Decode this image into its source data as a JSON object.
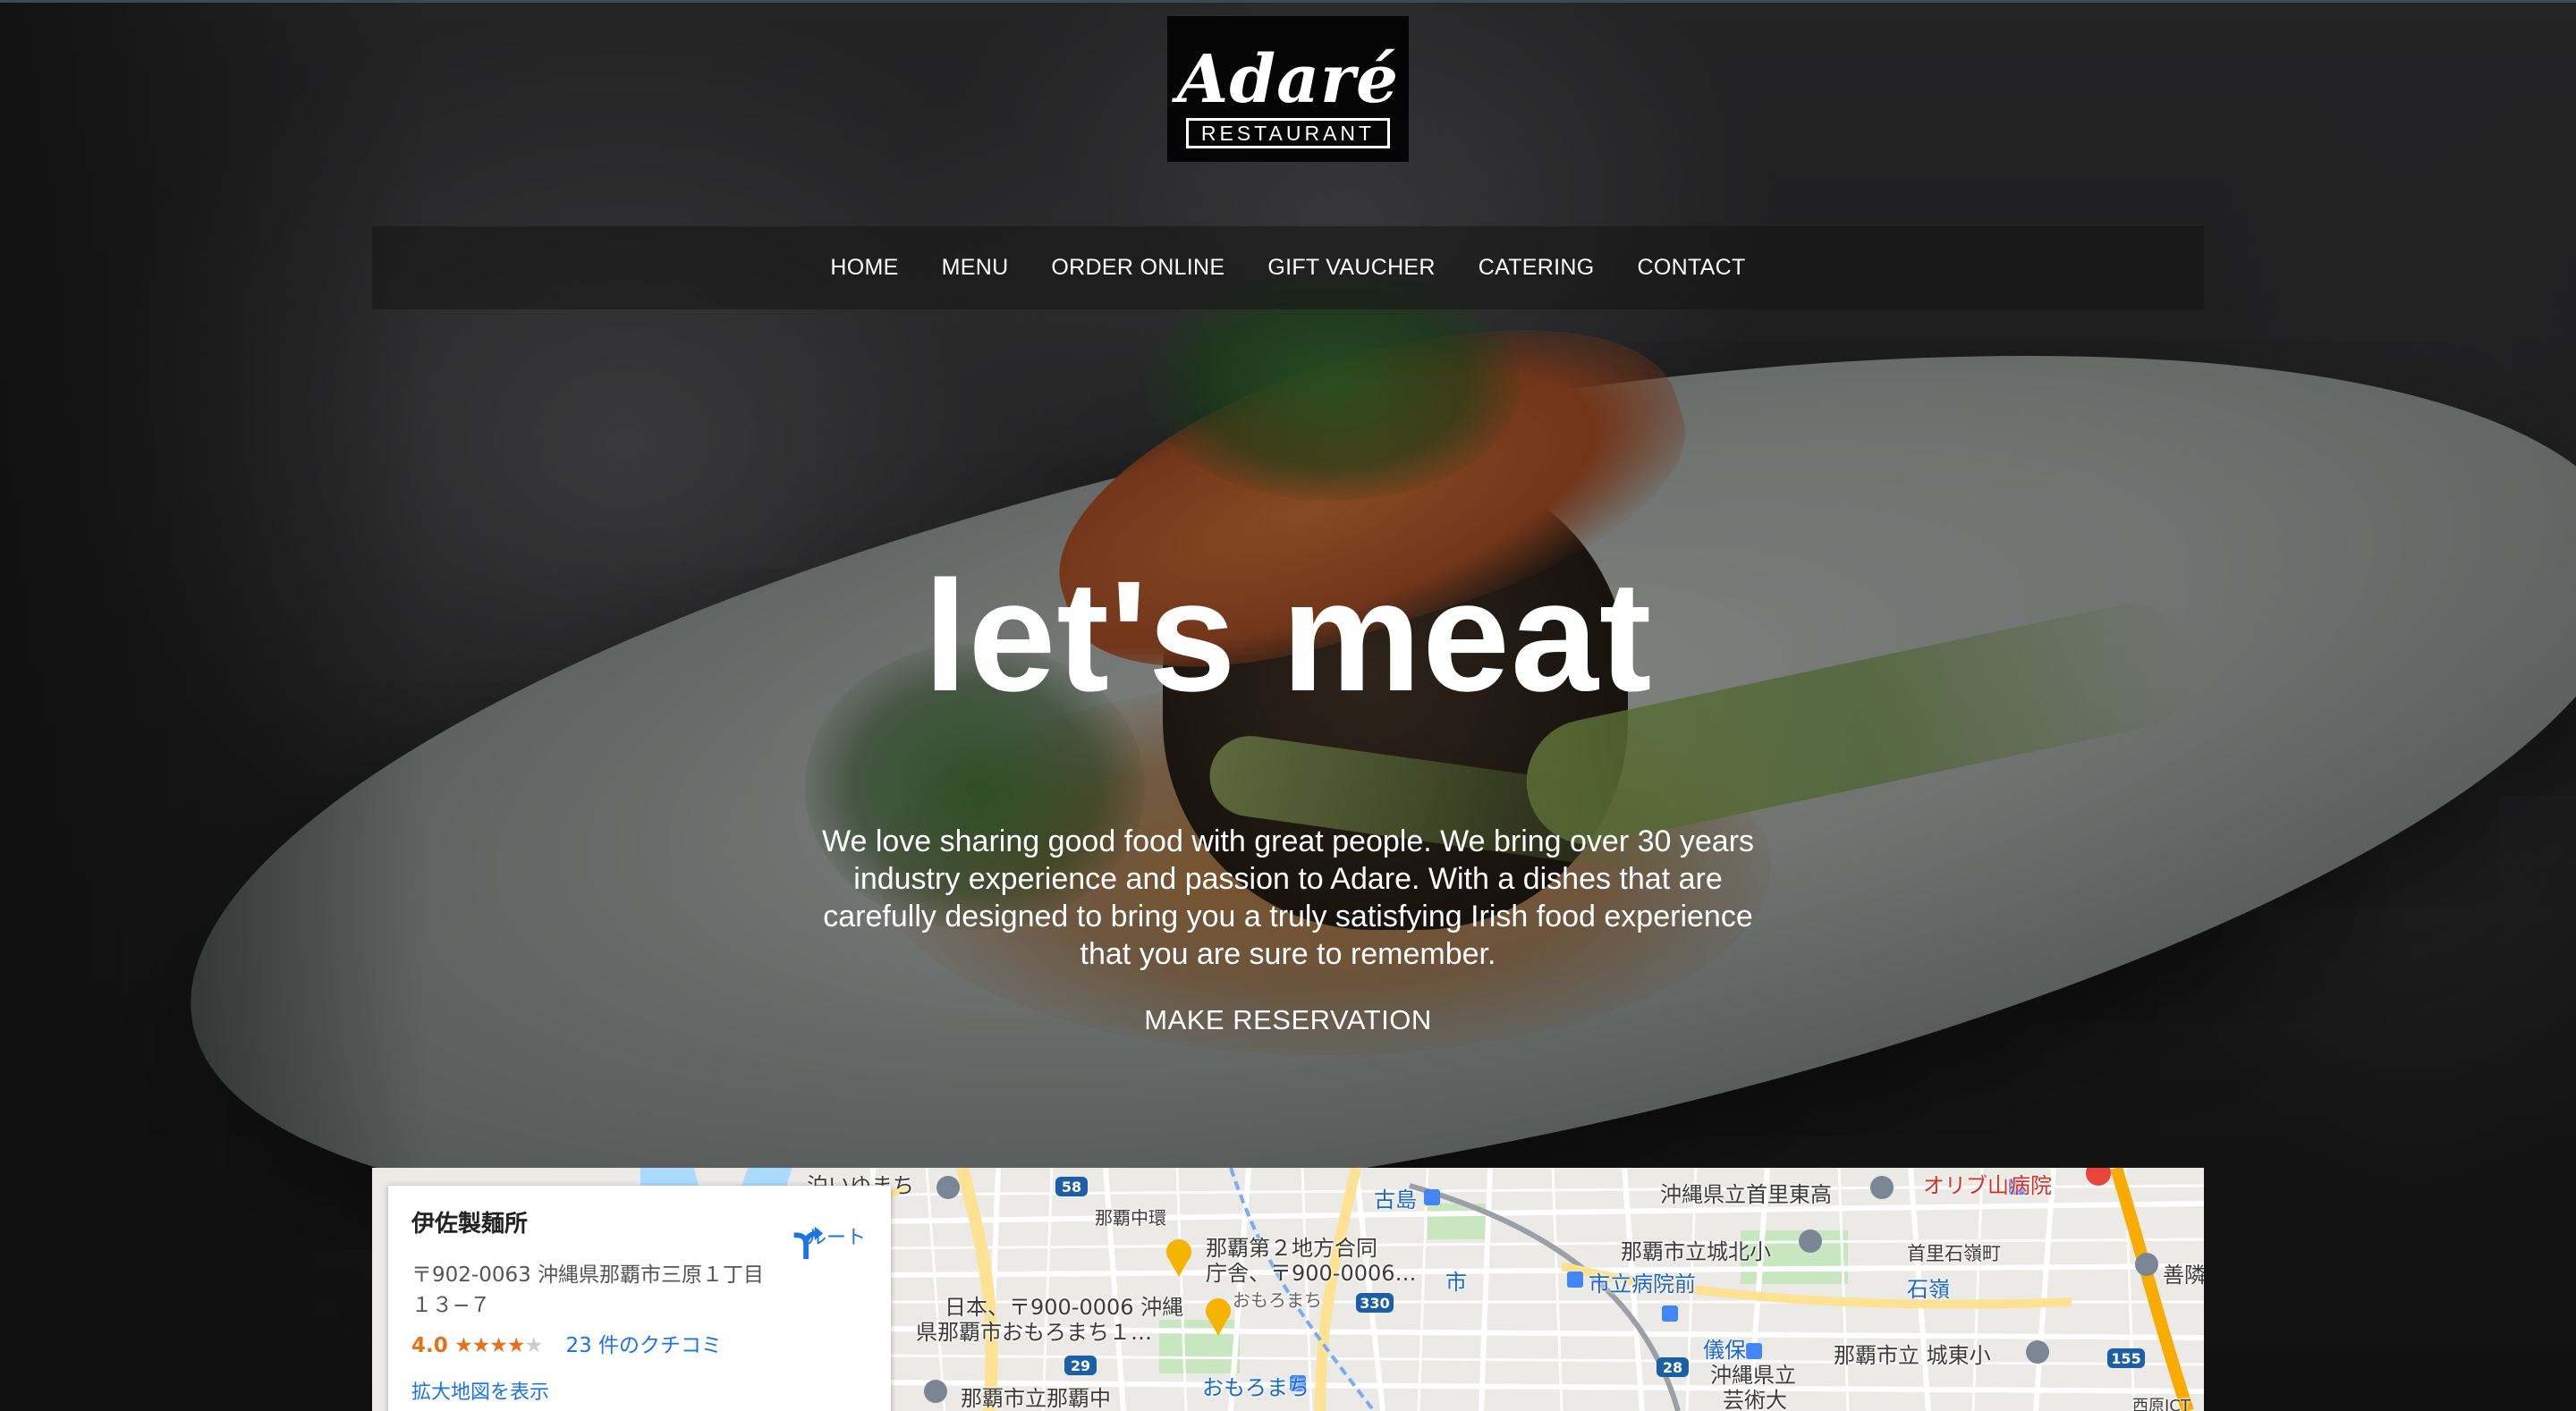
{
  "logo": {
    "word": "Adaré",
    "sub": "RESTAURANT"
  },
  "nav": {
    "items": [
      {
        "label": "HOME"
      },
      {
        "label": "MENU"
      },
      {
        "label": "ORDER ONLINE"
      },
      {
        "label": "GIFT VAUCHER"
      },
      {
        "label": "CATERING"
      },
      {
        "label": "CONTACT"
      }
    ]
  },
  "hero": {
    "title": "let's meat",
    "description": "We love sharing good food with great people. We bring over 30 years industry experience and passion to Adare. With a dishes that are carefully designed to bring you a truly satisfying Irish food experience that you are sure to remember.",
    "cta": "MAKE RESERVATION"
  },
  "map": {
    "card": {
      "title": "伊佐製麺所",
      "address": "〒902-0063 沖縄県那覇市三原１丁目１３−７",
      "rating": "4.0",
      "stars_full": "★★★★",
      "stars_empty": "★",
      "reviews": "23 件のクチコミ",
      "enlarge": "拡大地図を表示",
      "route": "ルート"
    },
    "labels": {
      "naha_chiho": "那覇第２地方合同",
      "chosha": "庁舎、〒900-0006…",
      "nihon": "日本、〒900-0006 沖縄",
      "naha_omoromachi": "県那覇市おもろまち１…",
      "omoromachi_small": "おもろまち",
      "omoromachi_station": "おもろまち",
      "naha_shiritsu_naha": "那覇市立那覇中",
      "naha_chu_hi": "那覇中環",
      "furujima": "古島",
      "shi": "市",
      "kenritsu_shuri": "沖縄県立首里東高",
      "oriyama": "オリブ山病院",
      "shiritsu_johoku": "那覇市立城北小",
      "shiritsu_byoin": "市立病院前",
      "shuri_ishimine": "首里石嶺町",
      "ishimine": "石嶺",
      "gibo": "儀保",
      "kenritsu_geijutsu": "沖縄県立",
      "geijutsudai": "芸術大",
      "jotou": "那覇市立 城東小",
      "zensho": "善隣",
      "uehara": "泊いゆまち",
      "nishihara": "西原JCT",
      "route_58": "58",
      "route_330": "330",
      "route_29": "29",
      "route_28": "28",
      "route_155": "155"
    }
  }
}
